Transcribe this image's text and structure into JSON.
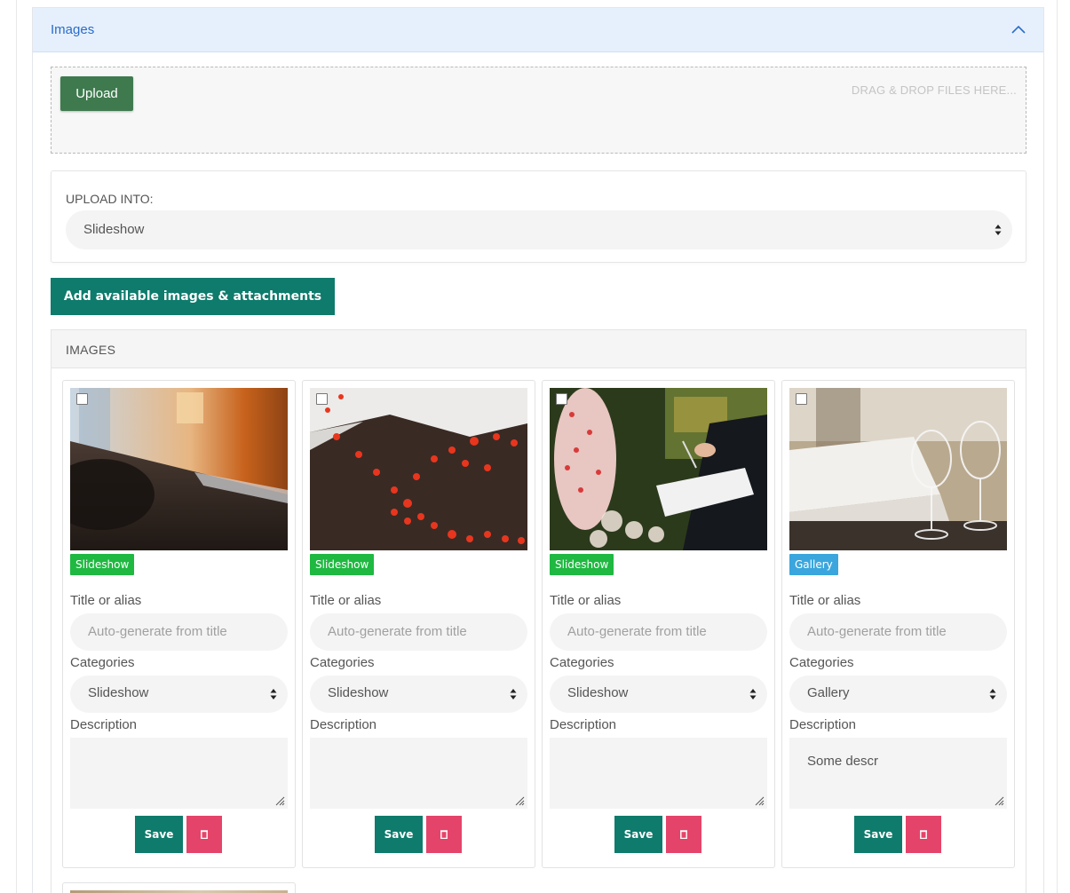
{
  "panel": {
    "title": "Images"
  },
  "dropzone": {
    "upload_label": "Upload",
    "hint": "DRAG & DROP FILES HERE..."
  },
  "upload_into": {
    "label": "UPLOAD INTO:",
    "selected": "Slideshow"
  },
  "add_button": {
    "label": "Add available images & attachments"
  },
  "images": {
    "title": "IMAGES",
    "cards": [
      {
        "badge": "Slideshow",
        "badge_color": "#1fb841",
        "title_label": "Title or alias",
        "title_placeholder": "Auto-generate from title",
        "categories_label": "Categories",
        "category": "Slideshow",
        "description_label": "Description",
        "description": "",
        "save_label": "Save"
      },
      {
        "badge": "Slideshow",
        "badge_color": "#1fb841",
        "title_label": "Title or alias",
        "title_placeholder": "Auto-generate from title",
        "categories_label": "Categories",
        "category": "Slideshow",
        "description_label": "Description",
        "description": "",
        "save_label": "Save"
      },
      {
        "badge": "Slideshow",
        "badge_color": "#1fb841",
        "title_label": "Title or alias",
        "title_placeholder": "Auto-generate from title",
        "categories_label": "Categories",
        "category": "Slideshow",
        "description_label": "Description",
        "description": "",
        "save_label": "Save"
      },
      {
        "badge": "Gallery",
        "badge_color": "#3aa6dd",
        "title_label": "Title or alias",
        "title_placeholder": "Auto-generate from title",
        "categories_label": "Categories",
        "category": "Gallery",
        "description_label": "Description",
        "description": "Some descr",
        "save_label": "Save"
      }
    ]
  },
  "colors": {
    "primary": "#0e7b6c",
    "upload": "#3f7a4f",
    "danger": "#e5446a",
    "header_bg": "#e6f0fd",
    "header_text": "#2a6cc8"
  }
}
